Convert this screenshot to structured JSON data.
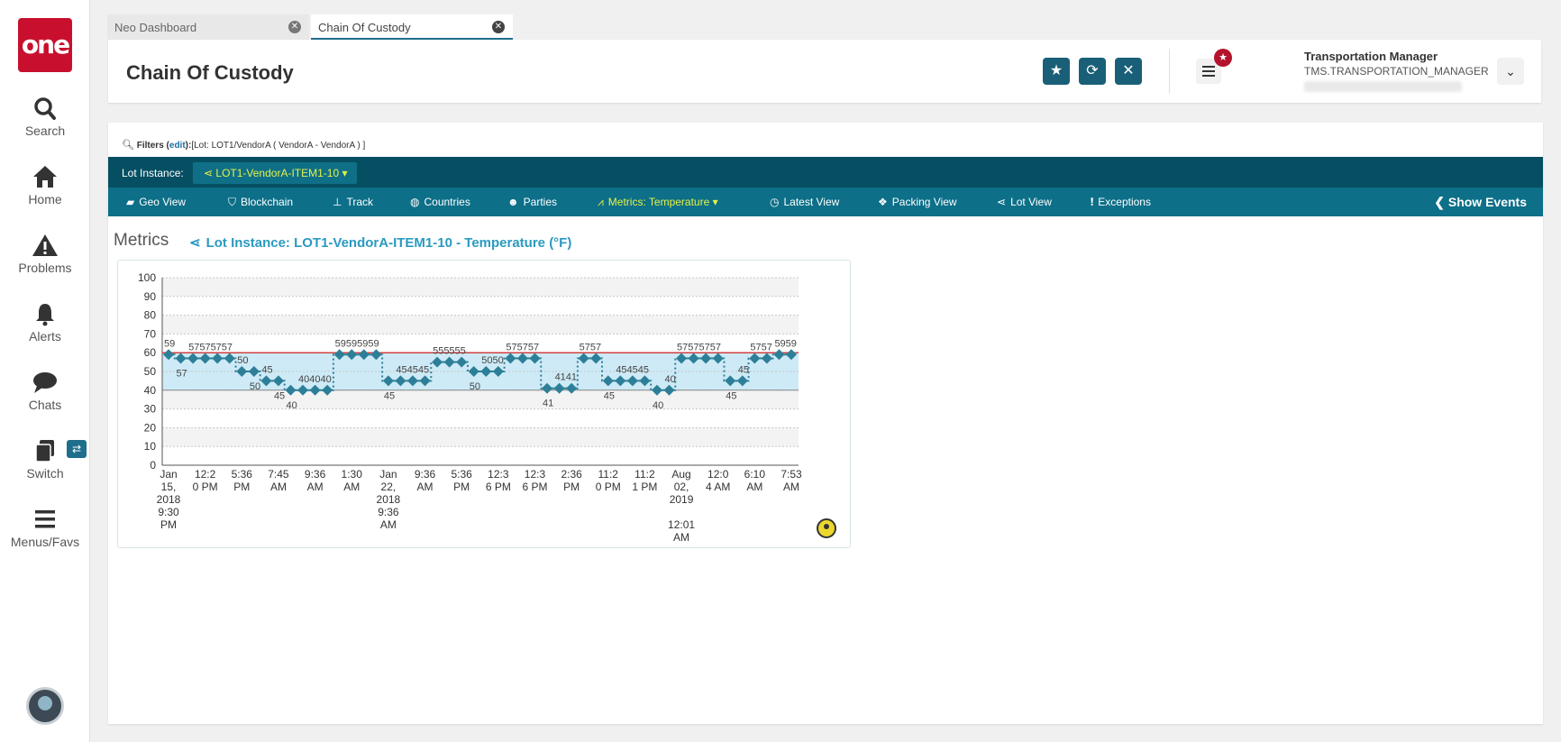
{
  "app": {
    "logo_text": "one"
  },
  "sidebar": {
    "items": [
      {
        "label": "Search",
        "icon": "search-icon"
      },
      {
        "label": "Home",
        "icon": "home-icon"
      },
      {
        "label": "Problems",
        "icon": "warning-icon"
      },
      {
        "label": "Alerts",
        "icon": "bell-icon"
      },
      {
        "label": "Chats",
        "icon": "chat-icon"
      },
      {
        "label": "Switch",
        "icon": "switch-icon"
      },
      {
        "label": "Menus/Favs",
        "icon": "menu-icon"
      }
    ]
  },
  "tabs": [
    {
      "label": "Neo Dashboard",
      "active": false
    },
    {
      "label": "Chain Of Custody",
      "active": true
    }
  ],
  "header": {
    "title": "Chain Of Custody",
    "buttons": {
      "favorite": "star-icon",
      "refresh": "refresh-icon",
      "close": "close-icon"
    },
    "user_name": "Transportation Manager",
    "user_role": "TMS.TRANSPORTATION_MANAGER"
  },
  "filters": {
    "label": "Filters",
    "edit": "edit",
    "value": "[Lot: LOT1/VendorA ( VendorA - VendorA ) ]"
  },
  "lot": {
    "label": "Lot Instance:",
    "selected": "LOT1-VendorA-ITEM1-10"
  },
  "toolbar": {
    "items": [
      {
        "label": "Geo View",
        "icon": "map-icon"
      },
      {
        "label": "Blockchain",
        "icon": "shield-icon"
      },
      {
        "label": "Track",
        "icon": "pin-icon"
      },
      {
        "label": "Countries",
        "icon": "globe-icon"
      },
      {
        "label": "Parties",
        "icon": "users-icon"
      },
      {
        "label": "Metrics: Temperature",
        "icon": "chart-icon",
        "active": true
      },
      {
        "label": "Latest View",
        "icon": "clock-icon"
      },
      {
        "label": "Packing View",
        "icon": "dropbox-icon"
      },
      {
        "label": "Lot View",
        "icon": "share-icon"
      },
      {
        "label": "Exceptions",
        "icon": "exclamation-icon"
      }
    ],
    "show_events": "Show Events"
  },
  "metrics": {
    "title": "Metrics",
    "subtitle": "Lot Instance: LOT1-VendorA-ITEM1-10 - Temperature (°F)"
  },
  "colors": {
    "accent": "#064f63",
    "toolbar": "#0d6f88",
    "highlight": "#e4f24a",
    "marker": "#2d7f98",
    "band": "#cdeaf6",
    "upper_line": "#d04040"
  },
  "chart_data": {
    "type": "line",
    "title": "",
    "ylim": [
      0,
      100
    ],
    "yticks": [
      0,
      10,
      20,
      30,
      40,
      50,
      60,
      70,
      80,
      90,
      100
    ],
    "band": [
      40,
      60
    ],
    "threshold_high": 60,
    "threshold_low": 40,
    "xtick_labels": [
      [
        "Jan",
        "15,",
        "2018",
        "9:30",
        "PM"
      ],
      [
        "12:2",
        "0 PM"
      ],
      [
        "5:36",
        "PM"
      ],
      [
        "7:45",
        "AM"
      ],
      [
        "9:36",
        "AM"
      ],
      [
        "1:30",
        "AM"
      ],
      [
        "Jan",
        "22,",
        "2018",
        "9:36",
        "AM"
      ],
      [
        "9:36",
        "AM"
      ],
      [
        "5:36",
        "PM"
      ],
      [
        "12:3",
        "6 PM"
      ],
      [
        "12:3",
        "6 PM"
      ],
      [
        "2:36",
        "PM"
      ],
      [
        "11:2",
        "0 PM"
      ],
      [
        "11:2",
        "1 PM"
      ],
      [
        "Aug",
        "02,",
        "2019",
        "",
        "12:01",
        "AM"
      ],
      [
        "12:0",
        "4 AM"
      ],
      [
        "6:10",
        "AM"
      ],
      [
        "7:53",
        "AM"
      ]
    ],
    "series": [
      {
        "values": [
          59,
          57,
          57,
          57,
          57,
          57,
          50,
          50,
          45,
          45,
          40,
          40,
          40,
          40,
          59,
          59,
          59,
          59,
          45,
          45,
          45,
          45,
          55,
          55,
          55,
          50,
          50,
          50,
          57,
          57,
          57,
          41,
          41,
          41,
          57,
          57,
          45,
          45,
          45,
          45,
          40,
          40,
          57,
          57,
          57,
          57,
          45,
          45,
          57,
          57,
          59,
          59
        ]
      }
    ],
    "point_labels": [
      {
        "index": 0,
        "text": "59",
        "pos": "above"
      },
      {
        "index": 1,
        "text": "57",
        "pos": "below"
      },
      {
        "index": 2,
        "text": "57575757",
        "pos": "above"
      },
      {
        "index": 6,
        "text": "50",
        "pos": "above"
      },
      {
        "index": 7,
        "text": "50",
        "pos": "below"
      },
      {
        "index": 8,
        "text": "45",
        "pos": "above"
      },
      {
        "index": 9,
        "text": "45",
        "pos": "below"
      },
      {
        "index": 10,
        "text": "40",
        "pos": "below"
      },
      {
        "index": 11,
        "text": "404040",
        "pos": "above"
      },
      {
        "index": 14,
        "text": "59595959",
        "pos": "above"
      },
      {
        "index": 18,
        "text": "45",
        "pos": "below"
      },
      {
        "index": 19,
        "text": "454545",
        "pos": "above"
      },
      {
        "index": 22,
        "text": "555555",
        "pos": "above"
      },
      {
        "index": 25,
        "text": "50",
        "pos": "below"
      },
      {
        "index": 26,
        "text": "5050",
        "pos": "above"
      },
      {
        "index": 28,
        "text": "575757",
        "pos": "above"
      },
      {
        "index": 31,
        "text": "41",
        "pos": "below"
      },
      {
        "index": 32,
        "text": "4141",
        "pos": "above"
      },
      {
        "index": 34,
        "text": "5757",
        "pos": "above"
      },
      {
        "index": 36,
        "text": "45",
        "pos": "below"
      },
      {
        "index": 37,
        "text": "454545",
        "pos": "above"
      },
      {
        "index": 40,
        "text": "40",
        "pos": "below"
      },
      {
        "index": 41,
        "text": "40",
        "pos": "above"
      },
      {
        "index": 42,
        "text": "57575757",
        "pos": "above"
      },
      {
        "index": 46,
        "text": "45",
        "pos": "below"
      },
      {
        "index": 47,
        "text": "45",
        "pos": "above"
      },
      {
        "index": 48,
        "text": "5757",
        "pos": "above"
      },
      {
        "index": 50,
        "text": "5959",
        "pos": "above"
      }
    ]
  }
}
